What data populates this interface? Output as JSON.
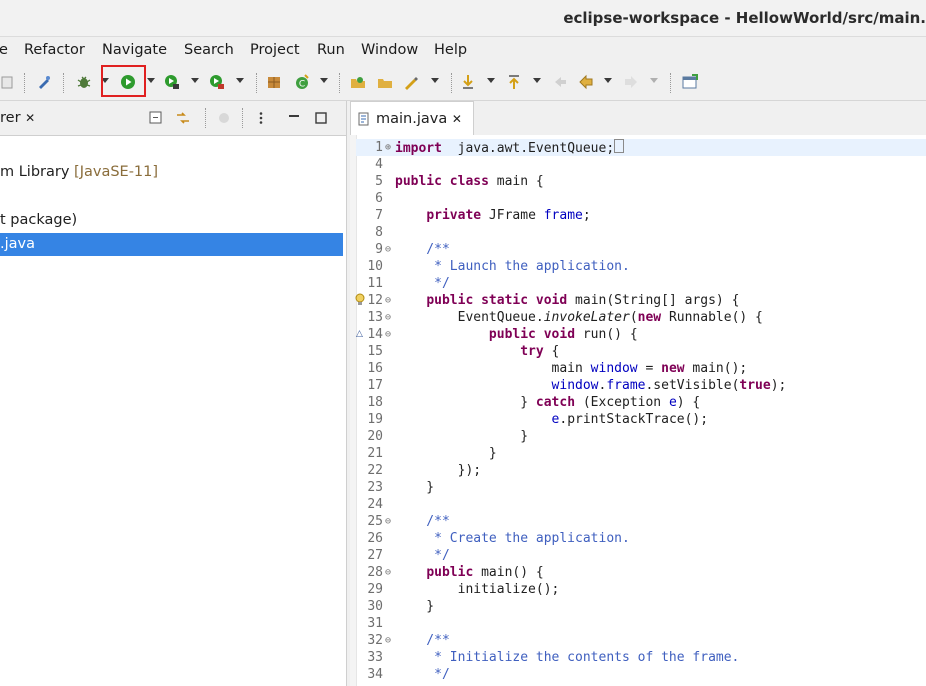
{
  "window": {
    "title": "eclipse-workspace - HellowWorld/src/main."
  },
  "menu": {
    "items": [
      "e",
      "Refactor",
      "Navigate",
      "Search",
      "Project",
      "Run",
      "Window",
      "Help"
    ]
  },
  "toolbar": {
    "icons": [
      "debug-icon",
      "run-icon",
      "coverage-icon",
      "external-tools-icon",
      "new-package-icon",
      "new-class-icon",
      "open-type-icon",
      "open-folder-icon",
      "pen-icon",
      "next-annotation-icon",
      "previous-annotation-icon",
      "last-edit-icon",
      "back-icon",
      "forward-icon",
      "perspective-icon"
    ],
    "highlight_color": "#e02020"
  },
  "left_panel": {
    "tab_label": "rer",
    "tree": [
      {
        "text": "m Library ",
        "suffix": "[JavaSE-11]"
      },
      {
        "text": "t package)"
      },
      {
        "text": ".java",
        "selected": true
      }
    ],
    "selection_color": "#3584e4"
  },
  "editor": {
    "tab_label": "main.java",
    "lines": [
      {
        "n": "1",
        "fold": "⊕",
        "tokens": [
          [
            "kw",
            "import"
          ],
          [
            "",
            "  java.awt.EventQueue;"
          ]
        ]
      },
      {
        "n": "4",
        "fold": "",
        "tokens": []
      },
      {
        "n": "5",
        "fold": "",
        "tokens": [
          [
            "kw",
            "public"
          ],
          [
            "",
            " "
          ],
          [
            "kw",
            "class"
          ],
          [
            "",
            " main {"
          ]
        ]
      },
      {
        "n": "6",
        "fold": "",
        "tokens": []
      },
      {
        "n": "7",
        "fold": "",
        "tokens": [
          [
            "",
            "    "
          ],
          [
            "kw",
            "private"
          ],
          [
            "",
            " JFrame "
          ],
          [
            "fld",
            "frame"
          ],
          [
            "",
            ";"
          ]
        ]
      },
      {
        "n": "8",
        "fold": "",
        "tokens": []
      },
      {
        "n": "9",
        "fold": "⊖",
        "tokens": [
          [
            "cmt",
            "    /**"
          ]
        ]
      },
      {
        "n": "10",
        "fold": "",
        "tokens": [
          [
            "cmt",
            "     * Launch the application."
          ]
        ]
      },
      {
        "n": "11",
        "fold": "",
        "tokens": [
          [
            "cmt",
            "     */"
          ]
        ]
      },
      {
        "n": "12",
        "fold": "⊖",
        "tokens": [
          [
            "",
            "    "
          ],
          [
            "kw",
            "public"
          ],
          [
            "",
            " "
          ],
          [
            "kw",
            "static"
          ],
          [
            "",
            " "
          ],
          [
            "kw",
            "void"
          ],
          [
            "",
            " main(String[] args) {"
          ]
        ]
      },
      {
        "n": "13",
        "fold": "⊖",
        "tokens": [
          [
            "",
            "        EventQueue."
          ],
          [
            "it",
            "invokeLater"
          ],
          [
            "",
            "("
          ],
          [
            "kw",
            "new"
          ],
          [
            "",
            " Runnable() {"
          ]
        ]
      },
      {
        "n": "14",
        "fold": "⊖",
        "tokens": [
          [
            "",
            "            "
          ],
          [
            "kw",
            "public"
          ],
          [
            "",
            " "
          ],
          [
            "kw",
            "void"
          ],
          [
            "",
            " run() {"
          ]
        ]
      },
      {
        "n": "15",
        "fold": "",
        "tokens": [
          [
            "",
            "                "
          ],
          [
            "kw",
            "try"
          ],
          [
            "",
            " {"
          ]
        ]
      },
      {
        "n": "16",
        "fold": "",
        "tokens": [
          [
            "",
            "                    main "
          ],
          [
            "fld",
            "window"
          ],
          [
            "",
            " = "
          ],
          [
            "kw",
            "new"
          ],
          [
            "",
            " main();"
          ]
        ]
      },
      {
        "n": "17",
        "fold": "",
        "tokens": [
          [
            "",
            "                    "
          ],
          [
            "fld",
            "window"
          ],
          [
            "",
            "."
          ],
          [
            "fld",
            "frame"
          ],
          [
            "",
            ".setVisible("
          ],
          [
            "kw",
            "true"
          ],
          [
            "",
            ");"
          ]
        ]
      },
      {
        "n": "18",
        "fold": "",
        "tokens": [
          [
            "",
            "                } "
          ],
          [
            "kw",
            "catch"
          ],
          [
            "",
            " (Exception "
          ],
          [
            "fld",
            "e"
          ],
          [
            "",
            ") {"
          ]
        ]
      },
      {
        "n": "19",
        "fold": "",
        "tokens": [
          [
            "",
            "                    "
          ],
          [
            "fld",
            "e"
          ],
          [
            "",
            ".printStackTrace();"
          ]
        ]
      },
      {
        "n": "20",
        "fold": "",
        "tokens": [
          [
            "",
            "                }"
          ]
        ]
      },
      {
        "n": "21",
        "fold": "",
        "tokens": [
          [
            "",
            "            }"
          ]
        ]
      },
      {
        "n": "22",
        "fold": "",
        "tokens": [
          [
            "",
            "        });"
          ]
        ]
      },
      {
        "n": "23",
        "fold": "",
        "tokens": [
          [
            "",
            "    }"
          ]
        ]
      },
      {
        "n": "24",
        "fold": "",
        "tokens": []
      },
      {
        "n": "25",
        "fold": "⊖",
        "tokens": [
          [
            "cmt",
            "    /**"
          ]
        ]
      },
      {
        "n": "26",
        "fold": "",
        "tokens": [
          [
            "cmt",
            "     * Create the application."
          ]
        ]
      },
      {
        "n": "27",
        "fold": "",
        "tokens": [
          [
            "cmt",
            "     */"
          ]
        ]
      },
      {
        "n": "28",
        "fold": "⊖",
        "tokens": [
          [
            "",
            "    "
          ],
          [
            "kw",
            "public"
          ],
          [
            "",
            " main() {"
          ]
        ]
      },
      {
        "n": "29",
        "fold": "",
        "tokens": [
          [
            "",
            "        initialize();"
          ]
        ]
      },
      {
        "n": "30",
        "fold": "",
        "tokens": [
          [
            "",
            "    }"
          ]
        ]
      },
      {
        "n": "31",
        "fold": "",
        "tokens": []
      },
      {
        "n": "32",
        "fold": "⊖",
        "tokens": [
          [
            "cmt",
            "    /**"
          ]
        ]
      },
      {
        "n": "33",
        "fold": "",
        "tokens": [
          [
            "cmt",
            "     * Initialize the contents of the frame."
          ]
        ]
      },
      {
        "n": "34",
        "fold": "",
        "tokens": [
          [
            "cmt",
            "     */"
          ]
        ]
      }
    ]
  }
}
